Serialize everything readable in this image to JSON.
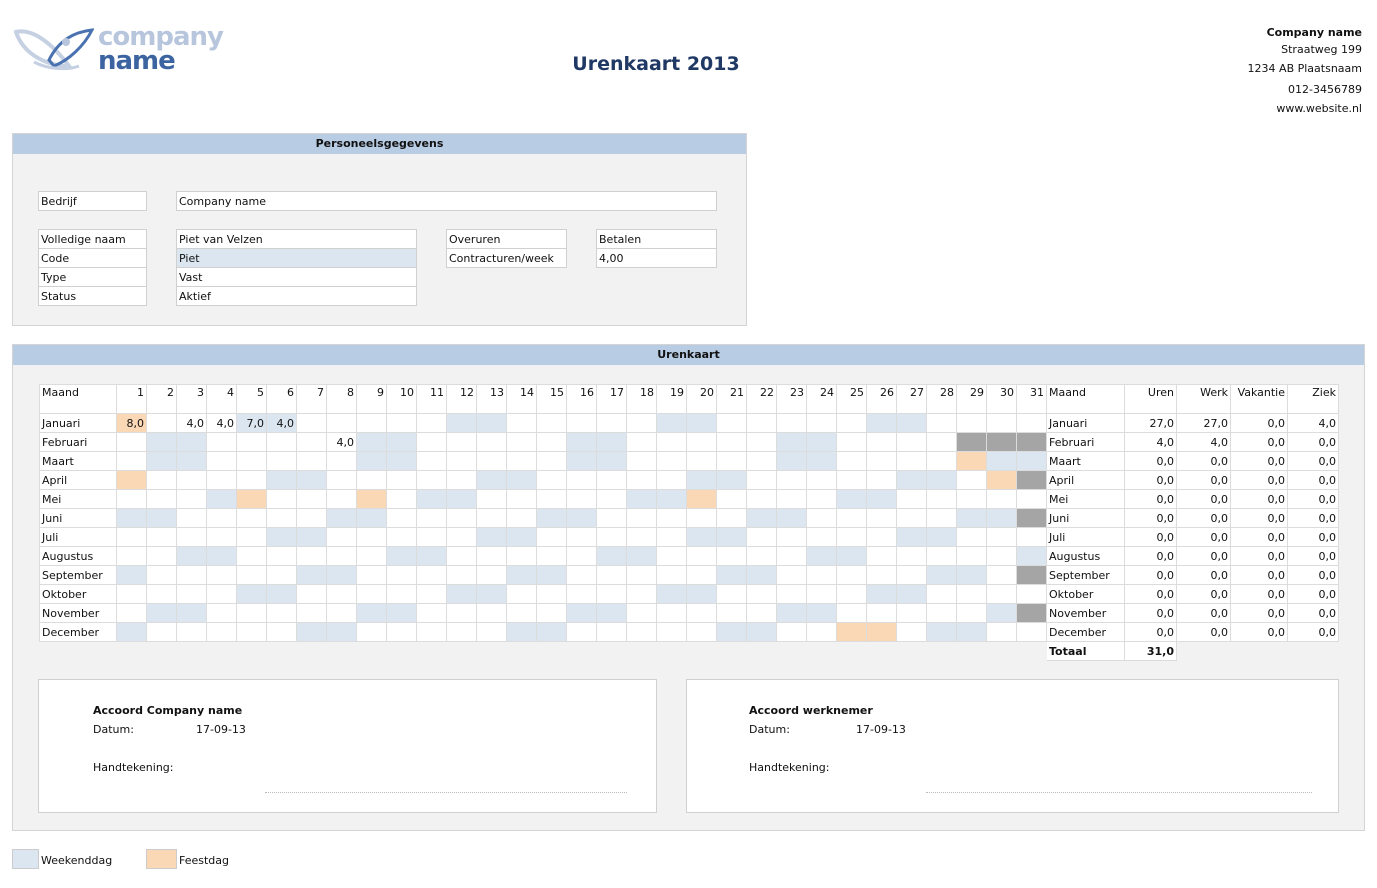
{
  "logo": {
    "line1": "company",
    "line2": "name"
  },
  "header": {
    "title": "Urenkaart 2013"
  },
  "address": {
    "company": "Company name",
    "street": "Straatweg 199",
    "city": "1234 AB Plaatsnaam",
    "phone": "012-3456789",
    "web": "www.website.nl"
  },
  "personnel": {
    "heading": "Personeelsgegevens",
    "bedrijf_label": "Bedrijf",
    "bedrijf_value": "Company name",
    "naam_label": "Volledige naam",
    "naam_value": "Piet van Velzen",
    "code_label": "Code",
    "code_value": "Piet",
    "type_label": "Type",
    "type_value": "Vast",
    "status_label": "Status",
    "status_value": "Aktief",
    "overuren_label": "Overuren",
    "overuren_value": "Betalen",
    "contract_label": "Contracturen/week",
    "contract_value": "4,00"
  },
  "timesheet": {
    "heading": "Urenkaart",
    "year": 2013,
    "col_maand": "Maand",
    "col_uren": "Uren",
    "col_werk": "Werk",
    "col_vakantie": "Vakantie",
    "col_ziek": "Ziek",
    "total_label": "Totaal",
    "total_value": "31,0",
    "months": [
      {
        "name": "Januari",
        "hours": {
          "1": "8,0",
          "3": "4,0",
          "4": "4,0",
          "5": "7,0",
          "6": "4,0"
        },
        "holidays": [
          1
        ],
        "uren": "27,0",
        "werk": "27,0",
        "vakantie": "0,0",
        "ziek": "4,0"
      },
      {
        "name": "Februari",
        "hours": {
          "8": "4,0"
        },
        "holidays": [],
        "uren": "4,0",
        "werk": "4,0",
        "vakantie": "0,0",
        "ziek": "0,0"
      },
      {
        "name": "Maart",
        "hours": {},
        "holidays": [
          29
        ],
        "uren": "0,0",
        "werk": "0,0",
        "vakantie": "0,0",
        "ziek": "0,0"
      },
      {
        "name": "April",
        "hours": {},
        "holidays": [
          1,
          30
        ],
        "uren": "0,0",
        "werk": "0,0",
        "vakantie": "0,0",
        "ziek": "0,0"
      },
      {
        "name": "Mei",
        "hours": {},
        "holidays": [
          5,
          9,
          20
        ],
        "uren": "0,0",
        "werk": "0,0",
        "vakantie": "0,0",
        "ziek": "0,0"
      },
      {
        "name": "Juni",
        "hours": {},
        "holidays": [],
        "uren": "0,0",
        "werk": "0,0",
        "vakantie": "0,0",
        "ziek": "0,0"
      },
      {
        "name": "Juli",
        "hours": {},
        "holidays": [],
        "uren": "0,0",
        "werk": "0,0",
        "vakantie": "0,0",
        "ziek": "0,0"
      },
      {
        "name": "Augustus",
        "hours": {},
        "holidays": [],
        "uren": "0,0",
        "werk": "0,0",
        "vakantie": "0,0",
        "ziek": "0,0"
      },
      {
        "name": "September",
        "hours": {},
        "holidays": [],
        "uren": "0,0",
        "werk": "0,0",
        "vakantie": "0,0",
        "ziek": "0,0"
      },
      {
        "name": "Oktober",
        "hours": {},
        "holidays": [],
        "uren": "0,0",
        "werk": "0,0",
        "vakantie": "0,0",
        "ziek": "0,0"
      },
      {
        "name": "November",
        "hours": {},
        "holidays": [],
        "uren": "0,0",
        "werk": "0,0",
        "vakantie": "0,0",
        "ziek": "0,0"
      },
      {
        "name": "December",
        "hours": {},
        "holidays": [
          25,
          26
        ],
        "uren": "0,0",
        "werk": "0,0",
        "vakantie": "0,0",
        "ziek": "0,0"
      }
    ]
  },
  "approval": {
    "company_title": "Accoord Company name",
    "company_date_label": "Datum:",
    "company_date": "17-09-13",
    "company_sign_label": "Handtekening:",
    "employee_title": "Accoord werknemer",
    "employee_date_label": "Datum:",
    "employee_date": "17-09-13",
    "employee_sign_label": "Handtekening:"
  },
  "legend": {
    "weekend": "Weekenddag",
    "holiday": "Feestdag"
  },
  "colors": {
    "weekend": "#dce6f1",
    "holiday": "#fad7b5",
    "invalid": "#a5a5a5",
    "header": "#b8cce4",
    "title": "#1f3864"
  }
}
